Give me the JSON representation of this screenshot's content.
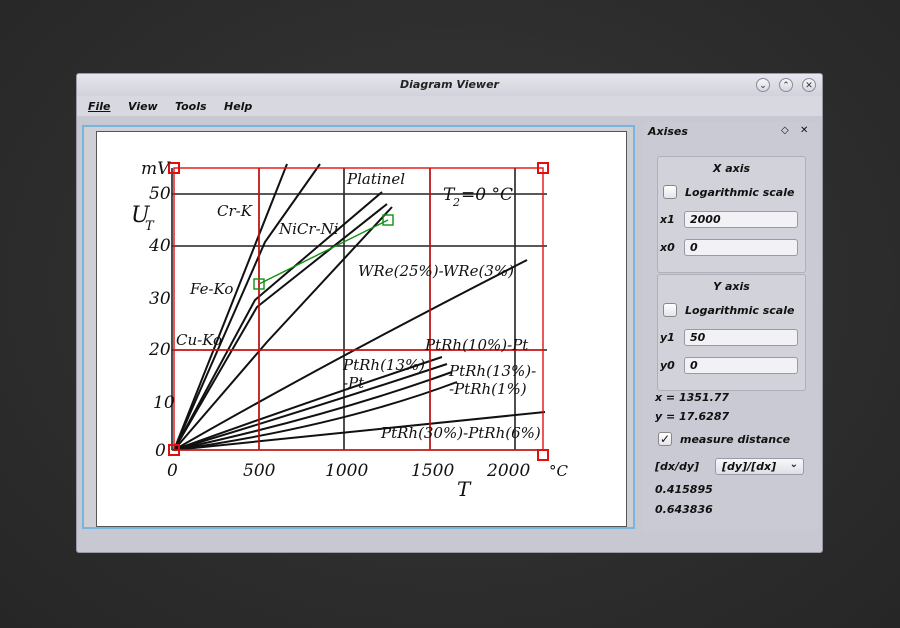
{
  "window": {
    "title": "Diagram Viewer"
  },
  "window_buttons": {
    "minimize": "⌄",
    "maximize": "⌃",
    "close": "✕"
  },
  "menu": {
    "file": "File",
    "view": "View",
    "tools": "Tools",
    "help": "Help"
  },
  "axes_panel": {
    "title": "Axises",
    "float_glyph": "◇",
    "close_glyph": "✕",
    "x_axis": {
      "title": "X axis",
      "log_label": "Logarithmic scale",
      "log_checked": false,
      "x1_label": "x1",
      "x1_value": "2000",
      "x0_label": "x0",
      "x0_value": "0"
    },
    "y_axis": {
      "title": "Y axis",
      "log_label": "Logarithmic scale",
      "log_checked": false,
      "y1_label": "y1",
      "y1_value": "50",
      "y0_label": "y0",
      "y0_value": "0"
    },
    "cursor_x": "x = 1351.77",
    "cursor_y": "y = 17.6287",
    "measure_label": "measure distance",
    "measure_checked": true,
    "ratio_label": "[dx/dy]",
    "ratio_select": "[dy]/[dx]",
    "result_1": "0.415895",
    "result_2": "0.643836"
  },
  "diagram": {
    "y_unit": "mV",
    "y_axis_symbol": "U",
    "y_axis_subscript": "T",
    "x_axis_symbol": "T",
    "x_unit": "°C",
    "annotation": "T",
    "annotation_subscript": "2",
    "annotation_rest": "=0 °C",
    "y_ticks": [
      "50",
      "40",
      "30",
      "20",
      "10",
      "0"
    ],
    "x_ticks": [
      "0",
      "500",
      "1000",
      "1500",
      "2000"
    ],
    "curve_labels": {
      "platinel": "Platinel",
      "cr_k": "Cr-K",
      "nicr_ni": "NiCr-Ni",
      "fe_ko": "Fe-Ko",
      "cu_ko": "Cu-Ko",
      "wre": "WRe(25%)-WRe(3%)",
      "ptrh10": "PtRh(10%)-Pt",
      "ptrh13_left_1": "PtRh(13%)",
      "ptrh13_left_2": "-Pt",
      "ptrh13_right_1": "PtRh(13%)-",
      "ptrh13_right_2": "-PtRh(1%)",
      "ptrh30": "PtRh(30%)-PtRh(6%)"
    }
  }
}
